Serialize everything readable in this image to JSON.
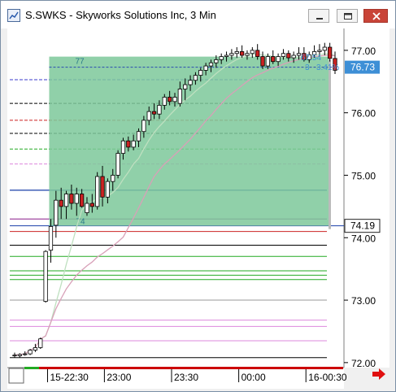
{
  "window": {
    "title": "S.SWKS - Skyworks Solutions Inc, 3 Min",
    "minimize_icon": "minimize-icon",
    "maximize_icon": "maximize-icon",
    "close_icon": "close-icon"
  },
  "chart_data": {
    "type": "candlestick",
    "symbol": "S.SWKS",
    "interval": "3 Min",
    "y_axis": {
      "ylim": [
        71.92,
        77.35
      ],
      "ticks": [
        "77.00",
        "76.00",
        "75.00",
        "74.00",
        "73.00",
        "72.00"
      ],
      "position": "right"
    },
    "x_axis": {
      "ticks": [
        "15-22:30",
        "23:00",
        "23:30",
        "00:00",
        "16-00:30"
      ]
    },
    "last_price": {
      "value": 76.73,
      "label": "76.73",
      "color": "#3d8fd6"
    },
    "marker_price": {
      "value": 74.19,
      "label": "74.19"
    },
    "bar_count": 73,
    "candles": [
      {
        "o": 72.12,
        "h": 72.16,
        "l": 72.08,
        "c": 72.12
      },
      {
        "o": 72.11,
        "h": 72.15,
        "l": 72.08,
        "c": 72.13
      },
      {
        "o": 72.13,
        "h": 72.18,
        "l": 72.11,
        "c": 72.14
      },
      {
        "o": 72.14,
        "h": 72.22,
        "l": 72.12,
        "c": 72.2
      },
      {
        "o": 72.2,
        "h": 72.3,
        "l": 72.17,
        "c": 72.24
      },
      {
        "o": 72.24,
        "h": 72.4,
        "l": 72.22,
        "c": 72.38
      },
      {
        "o": 72.98,
        "h": 73.8,
        "l": 72.96,
        "c": 73.78
      },
      {
        "o": 73.8,
        "h": 74.3,
        "l": 73.6,
        "c": 74.18
      },
      {
        "o": 74.2,
        "h": 74.75,
        "l": 74.0,
        "c": 74.6
      },
      {
        "o": 74.6,
        "h": 74.8,
        "l": 74.3,
        "c": 74.5
      },
      {
        "o": 74.5,
        "h": 74.75,
        "l": 74.3,
        "c": 74.7
      },
      {
        "o": 74.7,
        "h": 74.85,
        "l": 74.45,
        "c": 74.55
      },
      {
        "o": 74.55,
        "h": 74.8,
        "l": 74.35,
        "c": 74.7
      },
      {
        "o": 74.7,
        "h": 74.78,
        "l": 74.48,
        "c": 74.5
      },
      {
        "o": 74.4,
        "h": 74.65,
        "l": 74.35,
        "c": 74.55
      },
      {
        "o": 74.55,
        "h": 74.7,
        "l": 74.4,
        "c": 74.5
      },
      {
        "o": 74.5,
        "h": 75.05,
        "l": 74.45,
        "c": 74.98
      },
      {
        "o": 74.98,
        "h": 75.15,
        "l": 74.5,
        "c": 74.65
      },
      {
        "o": 74.65,
        "h": 74.95,
        "l": 74.55,
        "c": 74.9
      },
      {
        "o": 74.9,
        "h": 75.1,
        "l": 74.75,
        "c": 75.0
      },
      {
        "o": 75.0,
        "h": 75.4,
        "l": 74.95,
        "c": 75.35
      },
      {
        "o": 75.35,
        "h": 75.6,
        "l": 75.25,
        "c": 75.55
      },
      {
        "o": 75.55,
        "h": 75.62,
        "l": 75.38,
        "c": 75.45
      },
      {
        "o": 75.45,
        "h": 75.65,
        "l": 75.4,
        "c": 75.55
      },
      {
        "o": 75.55,
        "h": 75.75,
        "l": 75.45,
        "c": 75.7
      },
      {
        "o": 75.7,
        "h": 75.95,
        "l": 75.6,
        "c": 75.88
      },
      {
        "o": 75.88,
        "h": 76.1,
        "l": 75.8,
        "c": 76.02
      },
      {
        "o": 76.02,
        "h": 76.15,
        "l": 75.9,
        "c": 75.98
      },
      {
        "o": 75.98,
        "h": 76.2,
        "l": 75.9,
        "c": 76.12
      },
      {
        "o": 76.12,
        "h": 76.3,
        "l": 76.05,
        "c": 76.25
      },
      {
        "o": 76.25,
        "h": 76.35,
        "l": 76.12,
        "c": 76.18
      },
      {
        "o": 76.18,
        "h": 76.32,
        "l": 76.1,
        "c": 76.25
      },
      {
        "o": 76.15,
        "h": 76.5,
        "l": 76.1,
        "c": 76.38
      },
      {
        "o": 76.38,
        "h": 76.55,
        "l": 76.2,
        "c": 76.45
      },
      {
        "o": 76.45,
        "h": 76.6,
        "l": 76.35,
        "c": 76.52
      },
      {
        "o": 76.52,
        "h": 76.65,
        "l": 76.45,
        "c": 76.6
      },
      {
        "o": 76.6,
        "h": 76.72,
        "l": 76.5,
        "c": 76.68
      },
      {
        "o": 76.68,
        "h": 76.8,
        "l": 76.6,
        "c": 76.75
      },
      {
        "o": 76.75,
        "h": 76.85,
        "l": 76.65,
        "c": 76.8
      },
      {
        "o": 76.8,
        "h": 76.92,
        "l": 76.72,
        "c": 76.85
      },
      {
        "o": 76.85,
        "h": 76.95,
        "l": 76.78,
        "c": 76.9
      },
      {
        "o": 76.9,
        "h": 76.98,
        "l": 76.82,
        "c": 76.92
      },
      {
        "o": 76.92,
        "h": 77.02,
        "l": 76.85,
        "c": 76.95
      },
      {
        "o": 76.95,
        "h": 77.05,
        "l": 76.88,
        "c": 76.98
      },
      {
        "o": 76.98,
        "h": 77.08,
        "l": 76.88,
        "c": 76.92
      },
      {
        "o": 76.92,
        "h": 77.0,
        "l": 76.85,
        "c": 76.95
      },
      {
        "o": 76.95,
        "h": 77.05,
        "l": 76.88,
        "c": 77.0
      },
      {
        "o": 77.0,
        "h": 77.1,
        "l": 76.85,
        "c": 76.9
      },
      {
        "o": 76.9,
        "h": 76.98,
        "l": 76.7,
        "c": 76.75
      },
      {
        "o": 76.75,
        "h": 76.95,
        "l": 76.7,
        "c": 76.9
      },
      {
        "o": 76.9,
        "h": 77.0,
        "l": 76.78,
        "c": 76.82
      },
      {
        "o": 76.82,
        "h": 76.95,
        "l": 76.75,
        "c": 76.9
      },
      {
        "o": 76.9,
        "h": 77.02,
        "l": 76.85,
        "c": 76.95
      },
      {
        "o": 76.95,
        "h": 77.0,
        "l": 76.82,
        "c": 76.88
      },
      {
        "o": 76.88,
        "h": 76.98,
        "l": 76.8,
        "c": 76.92
      },
      {
        "o": 76.92,
        "h": 77.05,
        "l": 76.85,
        "c": 76.95
      },
      {
        "o": 76.95,
        "h": 77.05,
        "l": 76.82,
        "c": 76.85
      },
      {
        "o": 76.85,
        "h": 76.98,
        "l": 76.8,
        "c": 76.93
      },
      {
        "o": 76.93,
        "h": 77.08,
        "l": 76.88,
        "c": 76.98
      },
      {
        "o": 76.98,
        "h": 77.1,
        "l": 76.9,
        "c": 77.0
      },
      {
        "o": 77.0,
        "h": 77.12,
        "l": 76.92,
        "c": 77.05
      },
      {
        "o": 77.05,
        "h": 77.12,
        "l": 76.82,
        "c": 76.87
      },
      {
        "o": 76.87,
        "h": 76.98,
        "l": 76.62,
        "c": 76.68
      }
    ],
    "overlay_lines": [
      {
        "style": "dash",
        "color": "#3b3bcc",
        "price": 76.53
      },
      {
        "style": "dash",
        "color": "#000000",
        "price": 76.15
      },
      {
        "style": "dash",
        "color": "#cc2222",
        "price": 75.88
      },
      {
        "style": "dash",
        "color": "#000000",
        "price": 75.67
      },
      {
        "style": "dash",
        "color": "#22aa22",
        "price": 75.42
      },
      {
        "style": "dash",
        "color": "#dd88dd",
        "price": 75.18
      },
      {
        "style": "solid",
        "color": "#1a3fa8",
        "price": 74.76
      },
      {
        "style": "solid",
        "color": "#8a1a8a",
        "price": 74.3
      },
      {
        "style": "solid",
        "color": "#1a3fa8",
        "price": 74.19
      },
      {
        "style": "solid",
        "color": "#cc2222",
        "price": 74.1
      },
      {
        "style": "solid",
        "color": "#000000",
        "price": 73.88
      },
      {
        "style": "solid",
        "color": "#22aa22",
        "price": 73.7
      },
      {
        "style": "solid",
        "color": "#22aa22",
        "price": 73.47
      },
      {
        "style": "solid",
        "color": "#22aa22",
        "price": 73.4
      },
      {
        "style": "solid",
        "color": "#22aa22",
        "price": 73.33
      },
      {
        "style": "solid",
        "color": "#999999",
        "price": 73.0
      },
      {
        "style": "solid",
        "color": "#dd88dd",
        "price": 72.68
      },
      {
        "style": "solid",
        "color": "#dd88dd",
        "price": 72.58
      },
      {
        "style": "solid",
        "color": "#dd88dd",
        "price": 72.35
      },
      {
        "style": "solid",
        "color": "#000000",
        "price": 72.08
      }
    ],
    "highlight_box": {
      "from_bar": 7,
      "price_top": 76.73,
      "price_bottom": 74.19,
      "top_label": "77",
      "bottom_label": "74",
      "color": "#7cc89a"
    },
    "annotation": {
      "text_1": "67.54",
      "text_2": "3",
      "text_3": "3.41%",
      "color": "#3d8fd6"
    },
    "moving_averages": [
      {
        "color": "#bfe0c0",
        "values_start": 6
      },
      {
        "color": "#d8a0b8",
        "values_start": 6
      }
    ]
  }
}
